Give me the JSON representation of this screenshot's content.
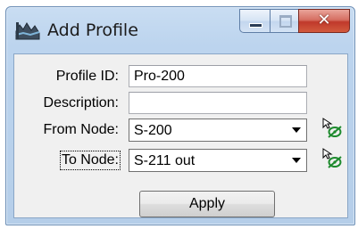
{
  "window": {
    "title": "Add Profile",
    "icons": {
      "app": "profile-app-icon",
      "minimize": "minimize-icon",
      "maximize": "maximize-icon",
      "close": "close-icon"
    }
  },
  "form": {
    "profile_id": {
      "label": "Profile ID:",
      "value": "Pro-200"
    },
    "description": {
      "label": "Description:",
      "value": ""
    },
    "from_node": {
      "label": "From Node:",
      "value": "S-200",
      "pick_icon": "node-pick-icon"
    },
    "to_node": {
      "label": "To Node:",
      "value": "S-211 out",
      "pick_icon": "node-pick-icon"
    },
    "apply_label": "Apply"
  },
  "colors": {
    "accent": "#1e8a2e",
    "close_button": "#c0392b",
    "frame": "#b5cee9"
  }
}
